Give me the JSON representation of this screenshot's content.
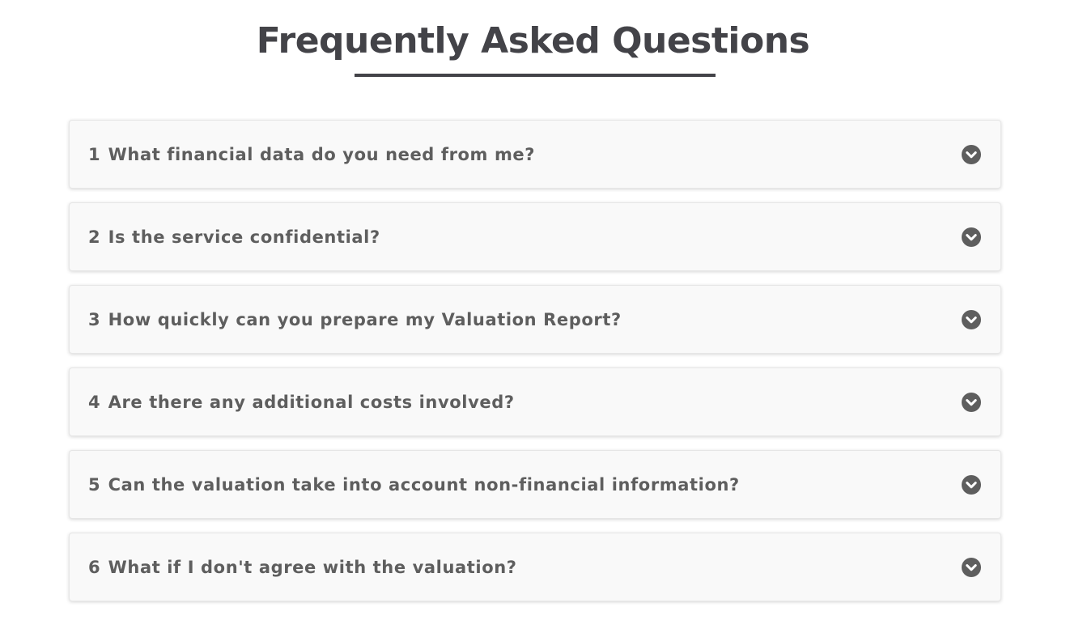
{
  "header": {
    "title": "Frequently Asked Questions"
  },
  "faq": {
    "items": [
      {
        "number": "1",
        "question": "What financial data do you need from me?"
      },
      {
        "number": "2",
        "question": "Is the service confidential?"
      },
      {
        "number": "3",
        "question": "How quickly can you prepare my Valuation Report?"
      },
      {
        "number": "4",
        "question": "Are there any additional costs involved?"
      },
      {
        "number": "5",
        "question": "Can the valuation take into account non-financial information?"
      },
      {
        "number": "6",
        "question": "What if I don't agree with the valuation?"
      }
    ],
    "expand_icon": "chevron-down-circle-icon"
  },
  "colors": {
    "heading": "#434348",
    "question_text": "#5e5e5e",
    "card_background": "#f9f9f9",
    "icon": "#5e5e5e"
  }
}
